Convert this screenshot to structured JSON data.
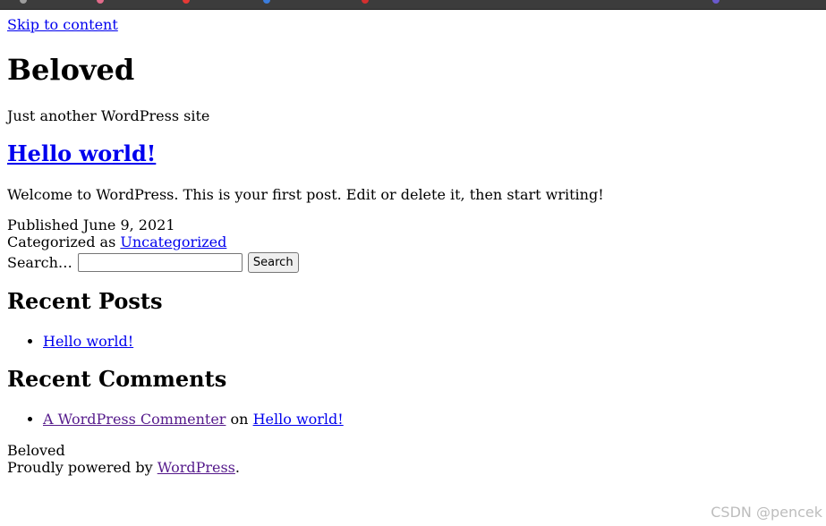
{
  "skip_link": "Skip to content",
  "site": {
    "title": "Beloved",
    "description": "Just another WordPress site"
  },
  "post": {
    "title": "Hello world!",
    "body": "Welcome to WordPress. This is your first post. Edit or delete it, then start writing!",
    "published_prefix": "Published",
    "published_date": "June 9, 2021",
    "categorized_prefix": "Categorized as",
    "category": "Uncategorized"
  },
  "search": {
    "label": "Search…",
    "value": "",
    "button": "Search"
  },
  "recent_posts": {
    "heading": "Recent Posts",
    "items": [
      "Hello world!"
    ]
  },
  "recent_comments": {
    "heading": "Recent Comments",
    "items": [
      {
        "author": "A WordPress Commenter",
        "connector": "on",
        "post": "Hello world!"
      }
    ]
  },
  "footer": {
    "site_name": "Beloved",
    "powered_prefix": "Proudly powered by",
    "powered_link": "WordPress",
    "powered_suffix": "."
  },
  "watermark": "CSDN @pencek",
  "colors": {
    "link": "#0000ee",
    "visited_link": "#551a8b",
    "topbar": "#3c3c3c"
  }
}
